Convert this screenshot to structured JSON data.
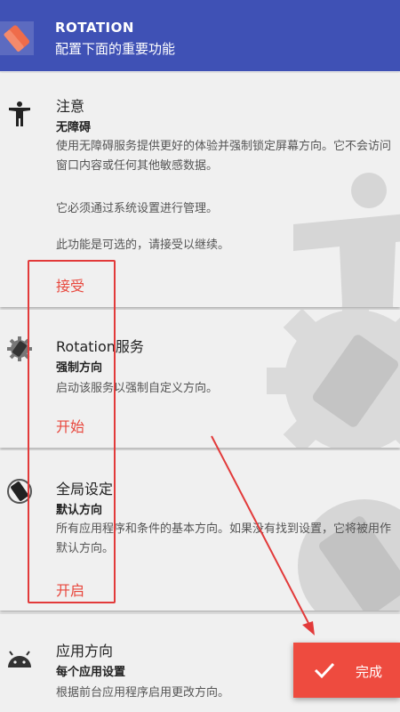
{
  "header": {
    "title": "ROTATION",
    "subtitle": "配置下面的重要功能",
    "icon": "rotation-app-icon",
    "color": "#3f51b5"
  },
  "cards": [
    {
      "icon": "accessibility-icon",
      "title": "注意",
      "subtitle": "无障碍",
      "paragraphs": [
        "使用无障碍服务提供更好的体验并强制锁定屏幕方向。它不会访问窗口内容或任何其他敏感数据。",
        "它必须通过系统设置进行管理。",
        "此功能是可选的，请接受以继续。"
      ],
      "action": "接受"
    },
    {
      "icon": "gear-rotation-icon",
      "title": "Rotation服务",
      "subtitle": "强制方向",
      "paragraphs": [
        "启动该服务以强制自定义方向。"
      ],
      "action": "开始"
    },
    {
      "icon": "phone-rotate-icon",
      "title": "全局设定",
      "subtitle": "默认方向",
      "paragraphs": [
        "所有应用程序和条件的基本方向。如果没有找到设置，它将被用作默认方向。"
      ],
      "action": "开启"
    },
    {
      "icon": "android-icon",
      "title": "应用方向",
      "subtitle": "每个应用设置",
      "paragraphs": [
        "根据前台应用程序启用更改方向。"
      ]
    }
  ],
  "fab": {
    "label": "完成",
    "icon": "check-icon",
    "color": "#ee4b3f"
  },
  "accent_color": "#e8473d",
  "annotation_color": "#e23a3a"
}
